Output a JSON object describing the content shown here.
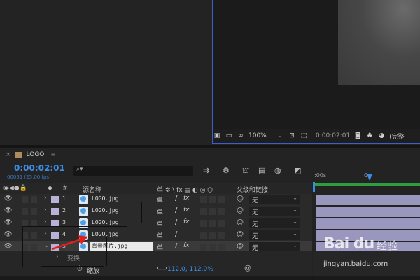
{
  "viewer": {
    "zoom": "100%",
    "timecode": "0:00:02:01",
    "quality": "(完整"
  },
  "comp_tab": {
    "close": "×",
    "name": "LOGO",
    "menu": "≡"
  },
  "timeline": {
    "timecode": "0:00:02:01",
    "frames": "00051 (25.00 fps)",
    "search_placeholder": "",
    "ruler_start": ":00s",
    "ruler_mark": "0"
  },
  "columns": {
    "hash": "#",
    "source_name": "源名称",
    "switches": "单 ✲ \\ fx ▤ ◐ ◎ ⬡",
    "parent": "父级和链接"
  },
  "layers": [
    {
      "num": "1",
      "name": "LOGO.jpg",
      "parent": "无"
    },
    {
      "num": "2",
      "name": "LOGO.jpg",
      "parent": "无"
    },
    {
      "num": "3",
      "name": "LOGO.jpg",
      "parent": "无"
    },
    {
      "num": "4",
      "name": "LOGO.jpg",
      "parent": "无"
    },
    {
      "num": "5",
      "name": "背景图片.jpg",
      "parent": "无"
    }
  ],
  "transform": {
    "label": "变换",
    "scale_label": "缩放",
    "scale_value": "112.0, 112.0%"
  },
  "watermark": {
    "logo": "Bai du",
    "text": "经验",
    "url": "jingyan.baidu.com"
  },
  "colors": {
    "accent": "#3d8ce4",
    "layer_label": "#b9b2d6",
    "work_area": "#2f9d3e"
  }
}
